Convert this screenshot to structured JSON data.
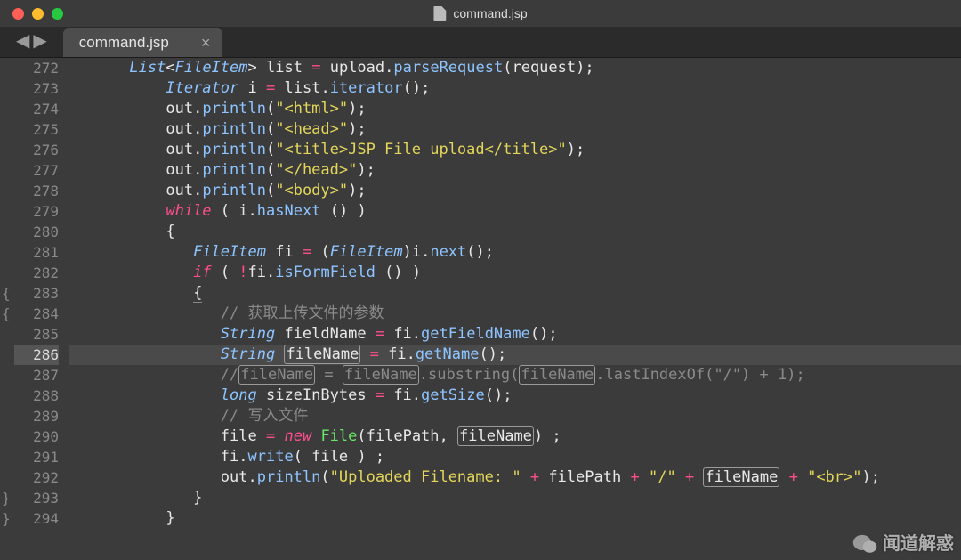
{
  "window": {
    "filename": "command.jsp"
  },
  "nav": {
    "back": "◀",
    "forward": "▶"
  },
  "tab": {
    "label": "command.jsp",
    "close": "×"
  },
  "fold": {
    "m1": "{",
    "m2": "{",
    "m3": "}",
    "m4": "}"
  },
  "lines": {
    "n272": "272",
    "n273": "273",
    "n274": "274",
    "n275": "275",
    "n276": "276",
    "n277": "277",
    "n278": "278",
    "n279": "279",
    "n280": "280",
    "n281": "281",
    "n282": "282",
    "n283": "283",
    "n284": "284",
    "n285": "285",
    "n286": "286",
    "n287": "287",
    "n288": "288",
    "n289": "289",
    "n290": "290",
    "n291": "291",
    "n292": "292",
    "n293": "293",
    "n294": "294"
  },
  "tok": {
    "List": "List",
    "FileItem": "FileItem",
    "Iterator": "Iterator",
    "String": "String",
    "long": "long",
    "File": "File",
    "list": "list",
    "upload": "upload",
    "request": "request",
    "i": "i",
    "out": "out",
    "fi": "fi",
    "fieldName": "fieldName",
    "fileName": "fileName",
    "sizeInBytes": "sizeInBytes",
    "file": "file",
    "filePath": "filePath",
    "parseRequest": "parseRequest",
    "iterator": "iterator",
    "println": "println",
    "hasNext": "hasNext",
    "next": "next",
    "isFormField": "isFormField",
    "getFieldName": "getFieldName",
    "getName": "getName",
    "getSize": "getSize",
    "write": "write",
    "substring": "substring",
    "lastIndexOf": "lastIndexOf",
    "while": "while",
    "if": "if",
    "new": "new",
    "eq": "=",
    "not": "!",
    "plus": "+",
    "one": "1",
    "lt": "<",
    "gt": ">",
    "lp": "(",
    "rp": ")",
    "lb": "{",
    "rb": "}",
    "sc": ";",
    "dot": ".",
    "cm": ",",
    "sp": " ",
    "s_html": "\"<html>\"",
    "s_head": "\"<head>\"",
    "s_title": "\"<title>JSP File upload</title>\"",
    "s_headc": "\"</head>\"",
    "s_body": "\"<body>\"",
    "s_up": "\"Uploaded Filename: \"",
    "s_slash": "\"/\"",
    "s_br": "\"<br>\"",
    "cmt1": "// 获取上传文件的参数",
    "cmt2": "// 写入文件",
    "cmt3": "//"
  },
  "watermark": {
    "text": "闻道解惑"
  }
}
